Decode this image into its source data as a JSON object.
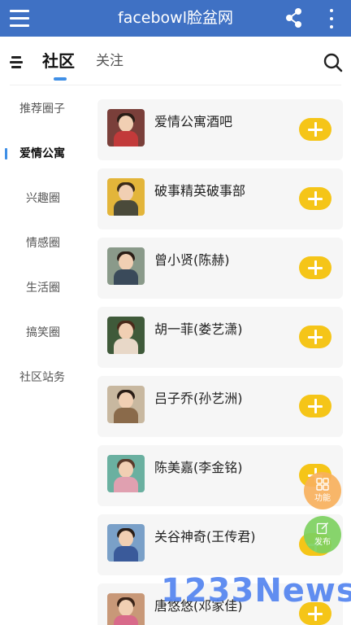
{
  "appbar": {
    "title": "facebowl脸盆网",
    "menu_icon": "hamburger-icon",
    "share_icon": "share-icon",
    "more_icon": "more-vertical-icon"
  },
  "tabs": [
    {
      "label": "社区",
      "selected": true
    },
    {
      "label": "关注",
      "selected": false
    }
  ],
  "sidebar": {
    "items": [
      {
        "label": "推荐圈子"
      },
      {
        "label": "爱情公寓",
        "active": true
      },
      {
        "label": "兴趣圈"
      },
      {
        "label": "情感圈"
      },
      {
        "label": "生活圈"
      },
      {
        "label": "搞笑圈"
      },
      {
        "label": "社区站务"
      }
    ]
  },
  "circles": [
    {
      "name": "爱情公寓酒吧"
    },
    {
      "name": "破事精英破事部"
    },
    {
      "name": "曾小贤(陈赫)"
    },
    {
      "name": "胡一菲(娄艺潇)"
    },
    {
      "name": "吕子乔(孙艺洲)"
    },
    {
      "name": "陈美嘉(李金铭)"
    },
    {
      "name": "关谷神奇(王传君)"
    },
    {
      "name": "唐悠悠(邓家佳)"
    }
  ],
  "fabs": {
    "functions_label": "功能",
    "post_label": "发布"
  },
  "watermark": "1233News",
  "colors": {
    "appbar": "#3f71c4",
    "accent": "#3f8fe6",
    "join_button": "#f5c518",
    "fab_functions": "#f7b05c",
    "fab_post": "#7dd060"
  }
}
